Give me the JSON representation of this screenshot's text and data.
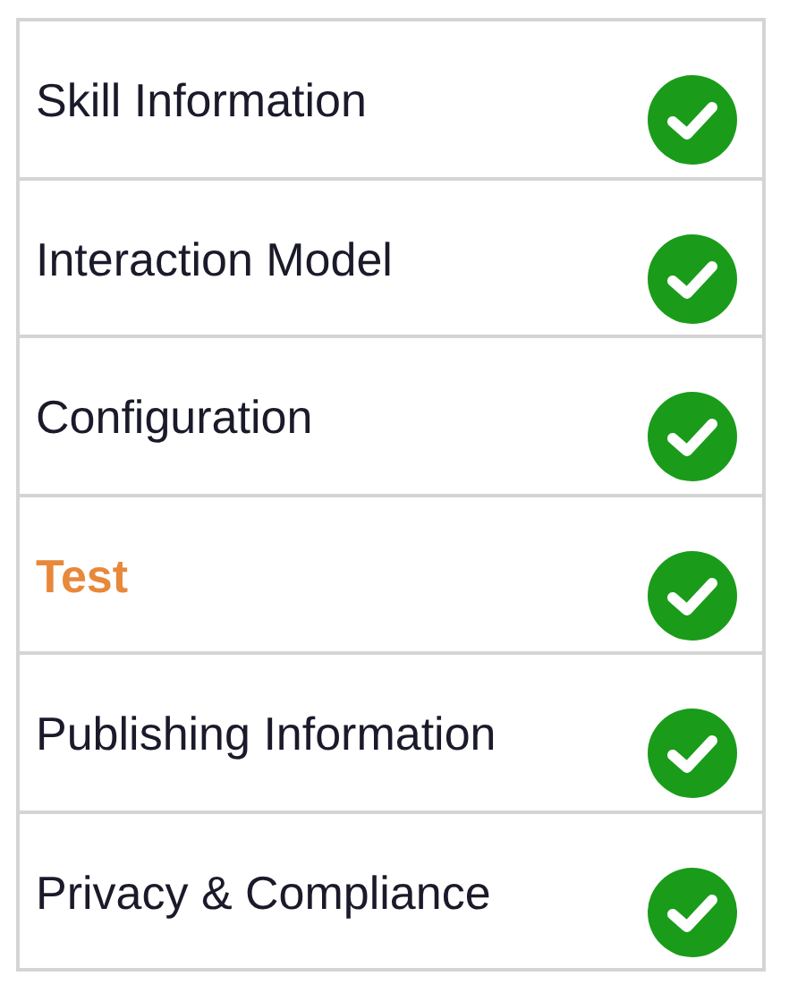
{
  "steps": [
    {
      "label": "Skill Information",
      "selected": false,
      "complete": true
    },
    {
      "label": "Interaction Model",
      "selected": false,
      "complete": true
    },
    {
      "label": "Configuration",
      "selected": false,
      "complete": true
    },
    {
      "label": "Test",
      "selected": true,
      "complete": true
    },
    {
      "label": "Publishing Information",
      "selected": false,
      "complete": true
    },
    {
      "label": "Privacy & Compliance",
      "selected": false,
      "complete": true
    }
  ]
}
